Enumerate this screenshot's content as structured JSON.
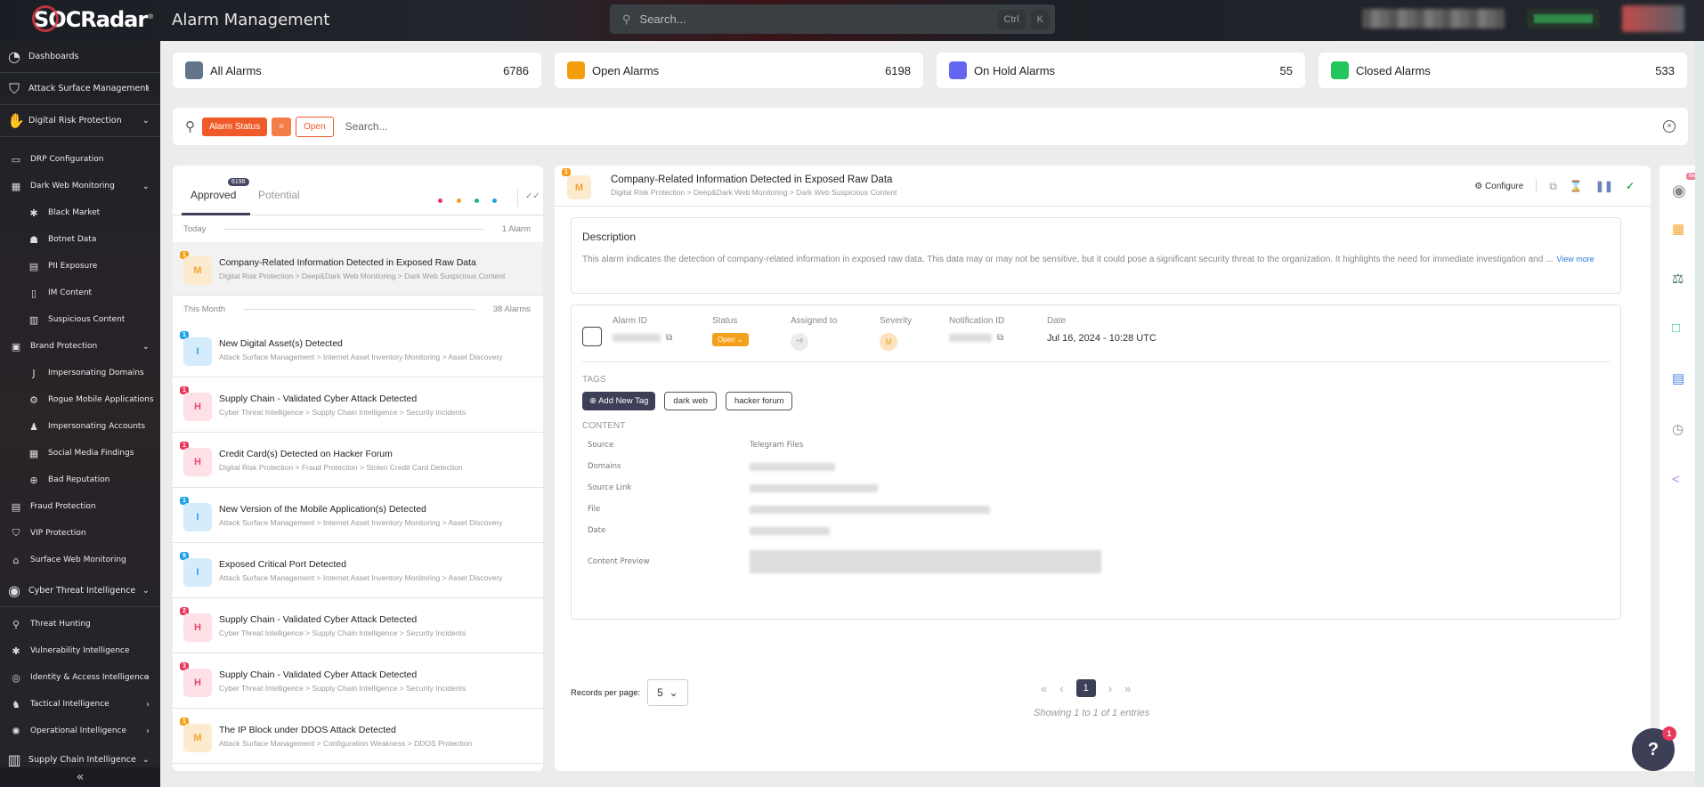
{
  "app": {
    "brand": "SOCRadar",
    "title": "Alarm Management"
  },
  "search": {
    "placeholder": "Search...",
    "shortcut": [
      "Ctrl",
      "K"
    ]
  },
  "sidebar": {
    "items": [
      {
        "label": "Dashboards",
        "icon": "dashboard-icon",
        "level": 1
      },
      {
        "label": "Attack Surface Management",
        "icon": "shield-scan-icon",
        "level": 1,
        "chevron": "right"
      },
      {
        "label": "Digital Risk Protection",
        "icon": "hand-icon",
        "level": 1,
        "chevron": "down"
      },
      {
        "label": "DRP Configuration",
        "icon": "monitor-icon",
        "level": 2
      },
      {
        "label": "Dark Web Monitoring",
        "icon": "building-icon",
        "level": 2,
        "chevron": "down"
      },
      {
        "label": "Black Market",
        "icon": "bug-icon",
        "level": 3
      },
      {
        "label": "Botnet Data",
        "icon": "robot-icon",
        "level": 3
      },
      {
        "label": "PII Exposure",
        "icon": "id-card-icon",
        "level": 3
      },
      {
        "label": "IM Content",
        "icon": "phone-icon",
        "level": 3
      },
      {
        "label": "Suspicious Content",
        "icon": "document-icon",
        "level": 3
      },
      {
        "label": "Brand Protection",
        "icon": "brand-icon",
        "level": 2,
        "chevron": "down"
      },
      {
        "label": "Impersonating Domains",
        "icon": "hook-icon",
        "level": 3
      },
      {
        "label": "Rogue Mobile Applications",
        "icon": "gear-icon",
        "level": 3
      },
      {
        "label": "Impersonating Accounts",
        "icon": "user-alert-icon",
        "level": 3
      },
      {
        "label": "Social Media Findings",
        "icon": "grid-icon",
        "level": 3
      },
      {
        "label": "Bad Reputation",
        "icon": "globe-icon",
        "level": 3
      },
      {
        "label": "Fraud Protection",
        "icon": "card-icon",
        "level": 2
      },
      {
        "label": "VIP Protection",
        "icon": "vip-shield-icon",
        "level": 2
      },
      {
        "label": "Surface Web Monitoring",
        "icon": "web-icon",
        "level": 2
      },
      {
        "label": "Cyber Threat Intelligence",
        "icon": "eye-shield-icon",
        "level": 1,
        "chevron": "down"
      },
      {
        "label": "Threat Hunting",
        "icon": "search-icon",
        "level": 2
      },
      {
        "label": "Vulnerability Intelligence",
        "icon": "bug-icon",
        "level": 2
      },
      {
        "label": "Identity & Access Intelligence",
        "icon": "fingerprint-icon",
        "level": 2,
        "chevron": "right"
      },
      {
        "label": "Tactical Intelligence",
        "icon": "chess-icon",
        "level": 2,
        "chevron": "right"
      },
      {
        "label": "Operational Intelligence",
        "icon": "virus-icon",
        "level": 2,
        "chevron": "right"
      },
      {
        "label": "Supply Chain Intelligence",
        "icon": "factory-icon",
        "level": 1,
        "chevron": "down"
      }
    ],
    "collapse": "«"
  },
  "stats": [
    {
      "label": "All Alarms",
      "value": "6786",
      "color": "#64748b"
    },
    {
      "label": "Open Alarms",
      "value": "6198",
      "color": "#f59e0b"
    },
    {
      "label": "On Hold Alarms",
      "value": "55",
      "color": "#6366f1"
    },
    {
      "label": "Closed Alarms",
      "value": "533",
      "color": "#22c55e"
    }
  ],
  "filter": {
    "chips": [
      "Alarm Status",
      "=",
      "Open"
    ],
    "placeholder": "Search..."
  },
  "list": {
    "tabs": [
      {
        "label": "Approved",
        "badge": "6198"
      },
      {
        "label": "Potential"
      }
    ],
    "dots": [
      "#e8375a",
      "#f3a01b",
      "#22b573",
      "#1ea3e6"
    ],
    "groups": [
      {
        "label": "Today",
        "count": "1 Alarm"
      },
      {
        "label": "This Month",
        "count": "38 Alarms"
      }
    ],
    "items": [
      {
        "sev": "M",
        "count": "1",
        "title": "Company-Related Information Detected in Exposed Raw Data",
        "path": "Digital Risk Protection > Deep&Dark Web Monitoring > Dark Web Suspicious Content"
      },
      {
        "sev": "I",
        "count": "1",
        "title": "New Digital Asset(s) Detected",
        "path": "Attack Surface Management > Internet Asset Inventory Monitoring > Asset Discovery"
      },
      {
        "sev": "H",
        "count": "1",
        "title": "Supply Chain - Validated Cyber Attack Detected",
        "path": "Cyber Threat Intelligence > Supply Chain Intelligence > Security Incidents"
      },
      {
        "sev": "H",
        "count": "1",
        "title": "Credit Card(s) Detected on Hacker Forum",
        "path": "Digital Risk Protection > Fraud Protection > Stolen Credit Card Detection"
      },
      {
        "sev": "I",
        "count": "1",
        "title": "New Version of the Mobile Application(s) Detected",
        "path": "Attack Surface Management > Internet Asset Inventory Monitoring > Asset Discovery"
      },
      {
        "sev": "I",
        "count": "9",
        "title": "Exposed Critical Port Detected",
        "path": "Attack Surface Management > Internet Asset Inventory Monitoring > Asset Discovery"
      },
      {
        "sev": "H",
        "count": "2",
        "title": "Supply Chain - Validated Cyber Attack Detected",
        "path": "Cyber Threat Intelligence > Supply Chain Intelligence > Security Incidents"
      },
      {
        "sev": "H",
        "count": "3",
        "title": "Supply Chain - Validated Cyber Attack Detected",
        "path": "Cyber Threat Intelligence > Supply Chain Intelligence > Security Incidents"
      },
      {
        "sev": "M",
        "count": "1",
        "title": "The IP Block under DDOS Attack Detected",
        "path": "Attack Surface Management > Configuration Weakness > DDOS Protection"
      }
    ]
  },
  "detail": {
    "sev": "M",
    "count": "1",
    "title": "Company-Related Information Detected in Exposed Raw Data",
    "path": "Digital Risk Protection > Deep&Dark Web Monitoring > Dark Web Suspicious Content",
    "configure": "Configure",
    "description_title": "Description",
    "description": "This alarm indicates the detection of company-related information in exposed raw data. This data may or may not be sensitive, but it could pose a significant security threat to the organization. It highlights the need for immediate investigation and ...",
    "view_more": "View more",
    "meta_headers": [
      "Alarm ID",
      "Status",
      "Assigned to",
      "Severity",
      "Notification ID",
      "Date"
    ],
    "status": "Open",
    "assigned": "+8",
    "severity": "M",
    "date": "Jul 16, 2024 - 10:28 UTC",
    "tags_label": "TAGS",
    "add_tag": "Add New Tag",
    "tags": [
      "dark web",
      "hacker forum"
    ],
    "content_label": "CONTENT",
    "content": [
      {
        "key": "Source",
        "value": "Telegram Files"
      },
      {
        "key": "Domains",
        "value": ""
      },
      {
        "key": "Source Link",
        "value": ""
      },
      {
        "key": "File",
        "value": ""
      },
      {
        "key": "Date",
        "value": ""
      },
      {
        "key": "Content Preview",
        "value": ""
      }
    ]
  },
  "pager": {
    "rpp_label": "Records per page:",
    "rpp": "5",
    "page": "1",
    "showing": "Showing 1 to 1 of 1 entries"
  },
  "rail": {
    "beta": "Beta"
  },
  "help": {
    "badge": "1"
  }
}
